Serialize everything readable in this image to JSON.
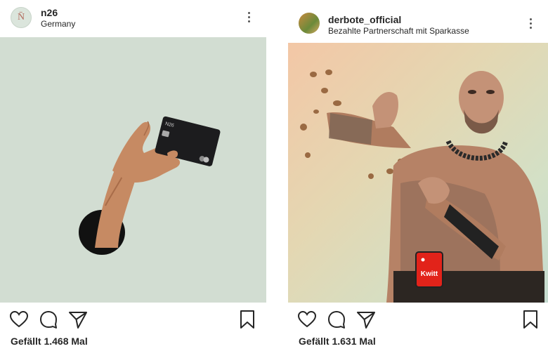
{
  "posts": [
    {
      "username": "n26",
      "subtitle": "Germany",
      "avatar_letter": "N̄",
      "likes_text": "Gefällt 1.468 Mal",
      "photo_subject": "hand holding black n26 bank card emerging from hole",
      "card_brand": "N26"
    },
    {
      "username": "derbote_official",
      "subtitle": "Bezahlte Partnerschaft mit Sparkasse",
      "likes_text": "Gefällt 1.631 Mal",
      "photo_subject": "tattooed man throwing coins, phone with Kwitt app in waistband",
      "phone_app_label": "Kwitt"
    }
  ],
  "icons": {
    "more": "more-vertical-icon",
    "like": "heart-icon",
    "comment": "comment-icon",
    "share": "paper-plane-icon",
    "save": "bookmark-icon"
  },
  "colors": {
    "text": "#262626",
    "n26_photo_bg": "#d2ddd2",
    "kwitt_red": "#e2231a"
  }
}
